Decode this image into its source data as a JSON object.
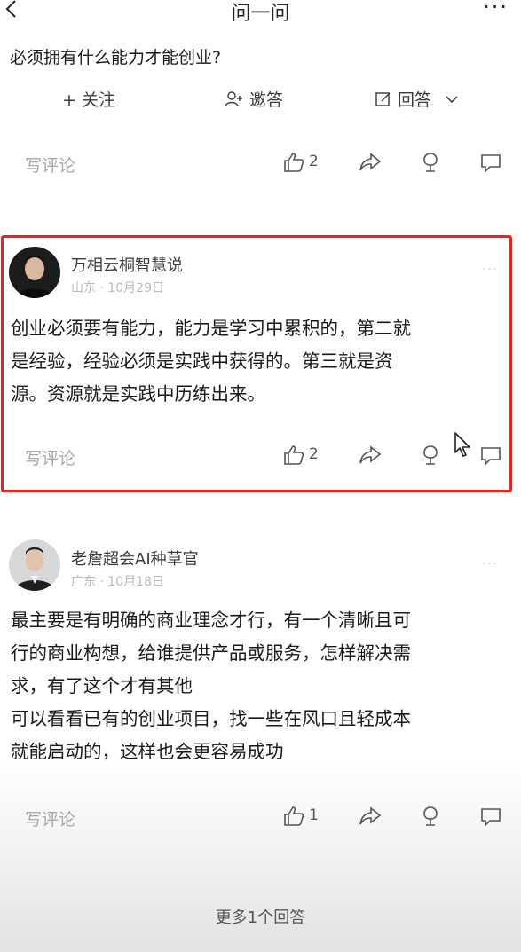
{
  "header": {
    "title": "问一问",
    "more": "···"
  },
  "question": {
    "text": "必须拥有什么能力才能创业?",
    "follow_label": "+ 关注",
    "invite_label": "邀答",
    "answer_label": "回答"
  },
  "question_actions": {
    "comment_placeholder": "写评论",
    "like_count": "2"
  },
  "answers": [
    {
      "author": "万相云桐智慧说",
      "meta": "山东 · 10月29日",
      "more": "···",
      "lines": [
        "创业必须要有能力，能力是学习中累积的，第二就",
        "是经验，经验必须是实践中获得的。第三就是资",
        "源。资源就是实践中历练出来。"
      ],
      "comment_placeholder": "写评论",
      "like_count": "2"
    },
    {
      "author": "老詹超会AI种草官",
      "meta": "广东 · 10月18日",
      "more": "···",
      "lines": [
        "最主要是有明确的商业理念才行，有一个清晰且可",
        "行的商业构想，给谁提供产品或服务，怎样解决需",
        "求，有了这个才有其他",
        "可以看看已有的创业项目，找一些在风口且轻成本",
        "就能启动的，这样也会更容易成功"
      ],
      "comment_placeholder": "写评论",
      "like_count": "1"
    }
  ],
  "footer": {
    "more_answers": "更多1个回答"
  },
  "colors": {
    "highlight_border": "#ee2020",
    "placeholder": "#a8a8a8"
  }
}
